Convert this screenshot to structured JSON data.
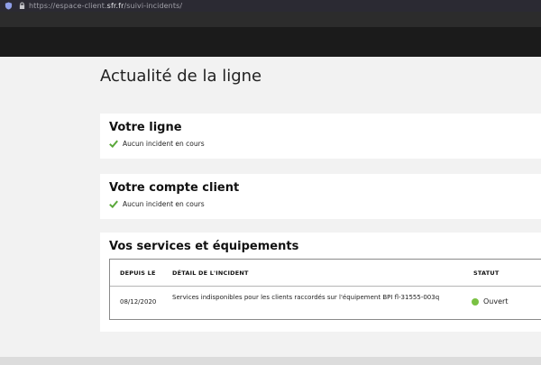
{
  "browser": {
    "url_prefix": "https://espace-client.",
    "url_host": "sfr.fr",
    "url_path": "/suivi-incidents/"
  },
  "page": {
    "title": "Actualité de la ligne"
  },
  "ligne_card": {
    "title": "Votre ligne",
    "status": "Aucun incident en cours"
  },
  "compte_card": {
    "title": "Votre compte client",
    "status": "Aucun incident en cours"
  },
  "services_card": {
    "title": "Vos services et équipements",
    "table": {
      "headers": {
        "depuis": "DEPUIS LE",
        "detail": "DÉTAIL DE L'INCIDENT",
        "statut": "STATUT"
      },
      "rows": [
        {
          "depuis": "08/12/2020",
          "detail": "Services indisponibles pour les clients raccordés sur l'équipement BPI fl-31555-003q",
          "statut": "Ouvert"
        }
      ]
    }
  },
  "colors": {
    "check": "#5aa83a",
    "status_open": "#7ac143",
    "header_bg": "#1b1b1b"
  },
  "icons": [
    "shield-icon",
    "lock-icon",
    "check-icon",
    "status-dot-icon"
  ]
}
